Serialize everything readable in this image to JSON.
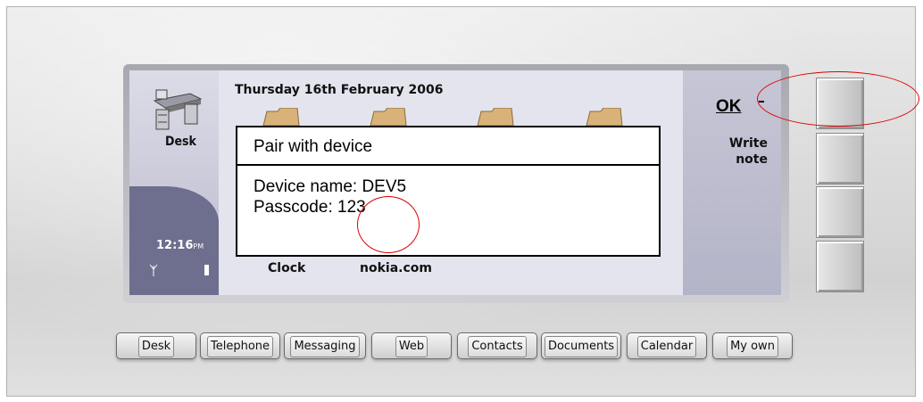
{
  "status": {
    "date": "Thursday 16th February 2006",
    "time": "12:16",
    "time_suffix": "PM"
  },
  "desk": {
    "label": "Desk"
  },
  "dialog": {
    "title": "Pair with device",
    "device_name": "Device name: DEV5",
    "passcode_label": "Passcode: ",
    "passcode_value": "123"
  },
  "desktop_items": [
    "Clock",
    "nokia.com"
  ],
  "softkeys": {
    "ok": "OK",
    "write_note": "Write",
    "write_note2": "note"
  },
  "tabs": [
    "Desk",
    "Telephone",
    "Messaging",
    "Web",
    "Contacts",
    "Documents",
    "Calendar",
    "My own"
  ],
  "colors": {
    "annotation": "#dd0000",
    "screen_bg": "#c8c8d8",
    "left_panel_dark": "#6e6e8e"
  }
}
